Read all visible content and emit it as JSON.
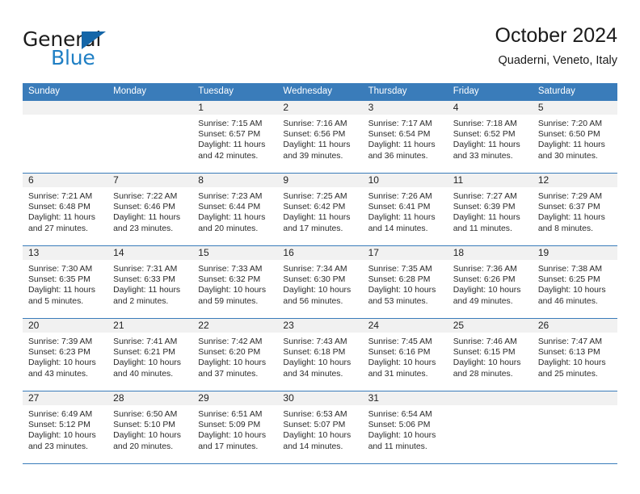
{
  "brand": {
    "name_top": "General",
    "name_bottom": "Blue",
    "triangle_icon": "triangle-icon",
    "accent_color": "#1f7fc4",
    "triangle_color": "#1466a8"
  },
  "header": {
    "title": "October 2024",
    "subtitle": "Quaderni, Veneto, Italy"
  },
  "theme": {
    "header_blue": "#3a7cba",
    "daystrip_gray": "#f1f1f1",
    "text_color": "#2a2a2a"
  },
  "calendar": {
    "day_headers": [
      "Sunday",
      "Monday",
      "Tuesday",
      "Wednesday",
      "Thursday",
      "Friday",
      "Saturday"
    ],
    "weeks": [
      [
        {
          "day": "",
          "lines": []
        },
        {
          "day": "",
          "lines": []
        },
        {
          "day": "1",
          "lines": [
            "Sunrise: 7:15 AM",
            "Sunset: 6:57 PM",
            "Daylight: 11 hours",
            "and 42 minutes."
          ]
        },
        {
          "day": "2",
          "lines": [
            "Sunrise: 7:16 AM",
            "Sunset: 6:56 PM",
            "Daylight: 11 hours",
            "and 39 minutes."
          ]
        },
        {
          "day": "3",
          "lines": [
            "Sunrise: 7:17 AM",
            "Sunset: 6:54 PM",
            "Daylight: 11 hours",
            "and 36 minutes."
          ]
        },
        {
          "day": "4",
          "lines": [
            "Sunrise: 7:18 AM",
            "Sunset: 6:52 PM",
            "Daylight: 11 hours",
            "and 33 minutes."
          ]
        },
        {
          "day": "5",
          "lines": [
            "Sunrise: 7:20 AM",
            "Sunset: 6:50 PM",
            "Daylight: 11 hours",
            "and 30 minutes."
          ]
        }
      ],
      [
        {
          "day": "6",
          "lines": [
            "Sunrise: 7:21 AM",
            "Sunset: 6:48 PM",
            "Daylight: 11 hours",
            "and 27 minutes."
          ]
        },
        {
          "day": "7",
          "lines": [
            "Sunrise: 7:22 AM",
            "Sunset: 6:46 PM",
            "Daylight: 11 hours",
            "and 23 minutes."
          ]
        },
        {
          "day": "8",
          "lines": [
            "Sunrise: 7:23 AM",
            "Sunset: 6:44 PM",
            "Daylight: 11 hours",
            "and 20 minutes."
          ]
        },
        {
          "day": "9",
          "lines": [
            "Sunrise: 7:25 AM",
            "Sunset: 6:42 PM",
            "Daylight: 11 hours",
            "and 17 minutes."
          ]
        },
        {
          "day": "10",
          "lines": [
            "Sunrise: 7:26 AM",
            "Sunset: 6:41 PM",
            "Daylight: 11 hours",
            "and 14 minutes."
          ]
        },
        {
          "day": "11",
          "lines": [
            "Sunrise: 7:27 AM",
            "Sunset: 6:39 PM",
            "Daylight: 11 hours",
            "and 11 minutes."
          ]
        },
        {
          "day": "12",
          "lines": [
            "Sunrise: 7:29 AM",
            "Sunset: 6:37 PM",
            "Daylight: 11 hours",
            "and 8 minutes."
          ]
        }
      ],
      [
        {
          "day": "13",
          "lines": [
            "Sunrise: 7:30 AM",
            "Sunset: 6:35 PM",
            "Daylight: 11 hours",
            "and 5 minutes."
          ]
        },
        {
          "day": "14",
          "lines": [
            "Sunrise: 7:31 AM",
            "Sunset: 6:33 PM",
            "Daylight: 11 hours",
            "and 2 minutes."
          ]
        },
        {
          "day": "15",
          "lines": [
            "Sunrise: 7:33 AM",
            "Sunset: 6:32 PM",
            "Daylight: 10 hours",
            "and 59 minutes."
          ]
        },
        {
          "day": "16",
          "lines": [
            "Sunrise: 7:34 AM",
            "Sunset: 6:30 PM",
            "Daylight: 10 hours",
            "and 56 minutes."
          ]
        },
        {
          "day": "17",
          "lines": [
            "Sunrise: 7:35 AM",
            "Sunset: 6:28 PM",
            "Daylight: 10 hours",
            "and 53 minutes."
          ]
        },
        {
          "day": "18",
          "lines": [
            "Sunrise: 7:36 AM",
            "Sunset: 6:26 PM",
            "Daylight: 10 hours",
            "and 49 minutes."
          ]
        },
        {
          "day": "19",
          "lines": [
            "Sunrise: 7:38 AM",
            "Sunset: 6:25 PM",
            "Daylight: 10 hours",
            "and 46 minutes."
          ]
        }
      ],
      [
        {
          "day": "20",
          "lines": [
            "Sunrise: 7:39 AM",
            "Sunset: 6:23 PM",
            "Daylight: 10 hours",
            "and 43 minutes."
          ]
        },
        {
          "day": "21",
          "lines": [
            "Sunrise: 7:41 AM",
            "Sunset: 6:21 PM",
            "Daylight: 10 hours",
            "and 40 minutes."
          ]
        },
        {
          "day": "22",
          "lines": [
            "Sunrise: 7:42 AM",
            "Sunset: 6:20 PM",
            "Daylight: 10 hours",
            "and 37 minutes."
          ]
        },
        {
          "day": "23",
          "lines": [
            "Sunrise: 7:43 AM",
            "Sunset: 6:18 PM",
            "Daylight: 10 hours",
            "and 34 minutes."
          ]
        },
        {
          "day": "24",
          "lines": [
            "Sunrise: 7:45 AM",
            "Sunset: 6:16 PM",
            "Daylight: 10 hours",
            "and 31 minutes."
          ]
        },
        {
          "day": "25",
          "lines": [
            "Sunrise: 7:46 AM",
            "Sunset: 6:15 PM",
            "Daylight: 10 hours",
            "and 28 minutes."
          ]
        },
        {
          "day": "26",
          "lines": [
            "Sunrise: 7:47 AM",
            "Sunset: 6:13 PM",
            "Daylight: 10 hours",
            "and 25 minutes."
          ]
        }
      ],
      [
        {
          "day": "27",
          "lines": [
            "Sunrise: 6:49 AM",
            "Sunset: 5:12 PM",
            "Daylight: 10 hours",
            "and 23 minutes."
          ]
        },
        {
          "day": "28",
          "lines": [
            "Sunrise: 6:50 AM",
            "Sunset: 5:10 PM",
            "Daylight: 10 hours",
            "and 20 minutes."
          ]
        },
        {
          "day": "29",
          "lines": [
            "Sunrise: 6:51 AM",
            "Sunset: 5:09 PM",
            "Daylight: 10 hours",
            "and 17 minutes."
          ]
        },
        {
          "day": "30",
          "lines": [
            "Sunrise: 6:53 AM",
            "Sunset: 5:07 PM",
            "Daylight: 10 hours",
            "and 14 minutes."
          ]
        },
        {
          "day": "31",
          "lines": [
            "Sunrise: 6:54 AM",
            "Sunset: 5:06 PM",
            "Daylight: 10 hours",
            "and 11 minutes."
          ]
        },
        {
          "day": "",
          "lines": []
        },
        {
          "day": "",
          "lines": []
        }
      ]
    ]
  }
}
